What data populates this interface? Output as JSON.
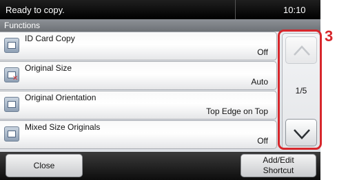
{
  "status_bar": {
    "message": "Ready to copy.",
    "time": "10:10"
  },
  "title_bar": {
    "title": "Functions"
  },
  "functions": [
    {
      "label": "ID Card Copy",
      "value": "Off",
      "icon": "id-card-copy-icon"
    },
    {
      "label": "Original Size",
      "value": "Auto",
      "icon": "original-size-icon"
    },
    {
      "label": "Original Orientation",
      "value": "Top Edge on Top",
      "icon": "original-orientation-icon"
    },
    {
      "label": "Mixed Size Originals",
      "value": "Off",
      "icon": "mixed-size-originals-icon"
    }
  ],
  "scroll": {
    "page_indicator": "1/5",
    "up_enabled": false,
    "down_enabled": true
  },
  "callout": {
    "step_number": "3",
    "color": "#d7262b"
  },
  "bottom_bar": {
    "close_label": "Close",
    "add_edit_line1": "Add/Edit",
    "add_edit_line2": "Shortcut"
  }
}
